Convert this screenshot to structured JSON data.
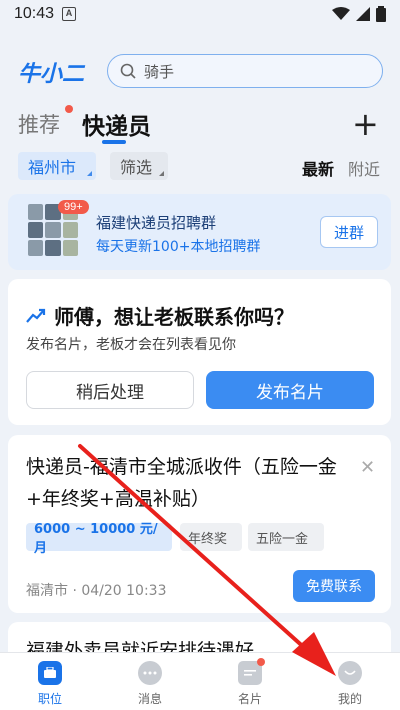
{
  "status_bar": {
    "time": "10:43",
    "a_icon_text": "A"
  },
  "app": {
    "logo": "牛小二"
  },
  "search": {
    "placeholder": "骑手"
  },
  "tabs": [
    {
      "label": "推荐",
      "has_dot": true
    },
    {
      "label": "快递员",
      "active": true
    }
  ],
  "filters": {
    "city": "福州市",
    "filter": "筛选",
    "sort_latest": "最新",
    "sort_nearby": "附近"
  },
  "group": {
    "badge": "99+",
    "title": "福建快递员招聘群",
    "subtitle": "每天更新100+本地招聘群",
    "join_label": "进群"
  },
  "promo": {
    "title": "师傅，想让老板联系你吗？",
    "subtitle": "发布名片，老板才会在列表看见你",
    "later_label": "稍后处理",
    "publish_label": "发布名片"
  },
  "job": {
    "title": "快递员-福清市全城派收件（五险一金+年终奖+高温补贴）",
    "salary": "6000 ~ 10000 元/月",
    "tags": [
      "年终奖",
      "五险一金"
    ],
    "meta": "福清市 · 04/20 10:33",
    "contact_label": "免费联系"
  },
  "next_job": {
    "title": "福建外卖员就近安排待遇好"
  },
  "bottom_nav": [
    {
      "label": "职位",
      "active": true
    },
    {
      "label": "消息"
    },
    {
      "label": "名片",
      "has_dot": true
    },
    {
      "label": "我的"
    }
  ],
  "colors": {
    "accent": "#1a73e8",
    "button": "#3b8cf2",
    "badge": "#f25a4a",
    "arrow": "#e8211c"
  }
}
